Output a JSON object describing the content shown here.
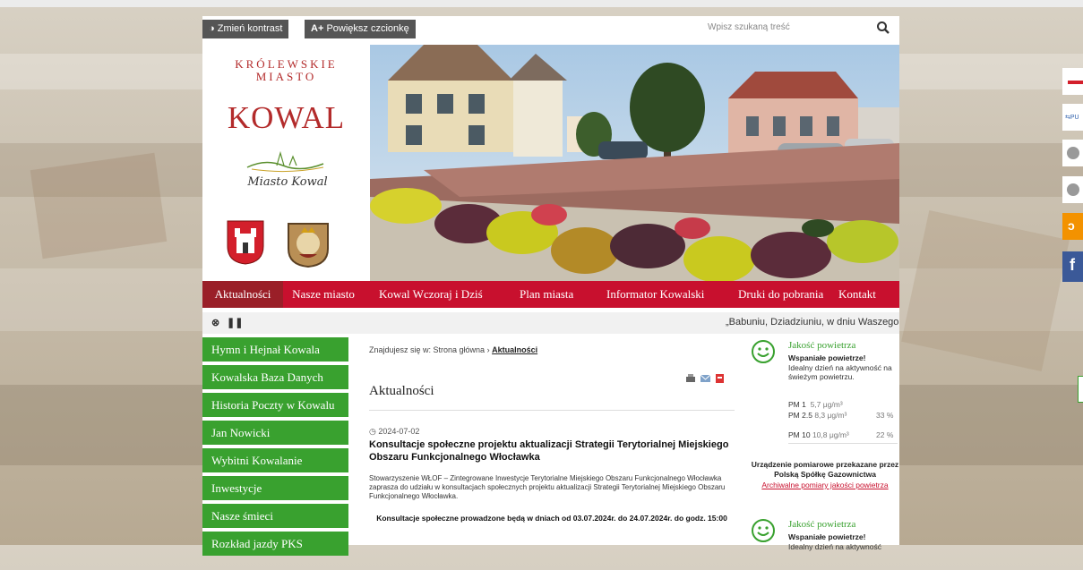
{
  "toolbar": {
    "contrast_label": "Zmień kontrast",
    "font_label": "Powiększ czcionkę",
    "font_prefix": "A+",
    "search_placeholder": "Wpisz szukaną treść"
  },
  "header": {
    "logo_line1": "KRÓLEWSKIE",
    "logo_line2": "MIASTO",
    "logo_name": "KOWAL",
    "logo_script": "Miasto Kowal"
  },
  "nav": [
    {
      "label": "Aktualności",
      "active": true
    },
    {
      "label": "Nasze miasto",
      "active": false
    },
    {
      "label": "Kowal Wczoraj i Dziś",
      "active": false
    },
    {
      "label": "Plan miasta",
      "active": false
    },
    {
      "label": "Informator Kowalski",
      "active": false
    },
    {
      "label": "Druki do pobrania",
      "active": false
    },
    {
      "label": "Kontakt",
      "active": false
    }
  ],
  "ticker": {
    "text": "„Babuniu, Dziadziuniu, w dniu Waszego ś"
  },
  "sidebar": [
    "Hymn i Hejnał Kowala",
    "Kowalska Baza Danych",
    "Historia Poczty w Kowalu",
    "Jan Nowicki",
    "Wybitni Kowalanie",
    "Inwestycje",
    "Nasze śmieci",
    "Rozkład jazdy PKS"
  ],
  "main": {
    "breadcrumb_prefix": "Znajdujesz się w: Strona główna ›",
    "breadcrumb_current": "Aktualności",
    "title": "Aktualności",
    "article": {
      "date": "2024-07-02",
      "title": "Konsultacje społeczne projektu aktualizacji Strategii Terytorialnej Miejskiego Obszaru Funkcjonalnego Włocławka",
      "body": "Stowarzyszenie WŁOF – Zintegrowane Inwestycje Terytorialne Miejskiego Obszaru Funkcjonalnego Włocławka zaprasza do udziału w konsultacjach społecznych projektu aktualizacji Strategii Terytorialnej Miejskiego Obszaru Funkcjonalnego Włocławka.",
      "highlight": "Konsultacje społeczne prowadzone będą w dniach od 03.07.2024r. do 24.07.2024r. do godz. 15:00"
    }
  },
  "air": [
    {
      "title": "Jakość powietrza",
      "status": "Wspaniałe powietrze!",
      "desc": "Idealny dzień na aktywność na świeżym powietrzu.",
      "pm1_label": "PM 1",
      "pm1_value": "5,7 μg/m³",
      "pm25_label": "PM 2.5",
      "pm25_value": "8,3 μg/m³",
      "pm25_pct": "33 %",
      "pm10_label": "PM 10",
      "pm10_value": "10,8 μg/m³",
      "pm10_pct": "22 %",
      "note": "Urządzenie pomiarowe przekazane przez Polską Spółkę Gazownictwa",
      "link": "Archiwalne pomiary jakości powietrza"
    },
    {
      "title": "Jakość powietrza",
      "status": "Wspaniałe powietrze!",
      "desc": "Idealny dzień na aktywność"
    }
  ],
  "colors": {
    "nav_red": "#c8102e",
    "nav_active": "#9a1f28",
    "sidebar_green": "#39a12f",
    "logo_red": "#b32b2b"
  }
}
